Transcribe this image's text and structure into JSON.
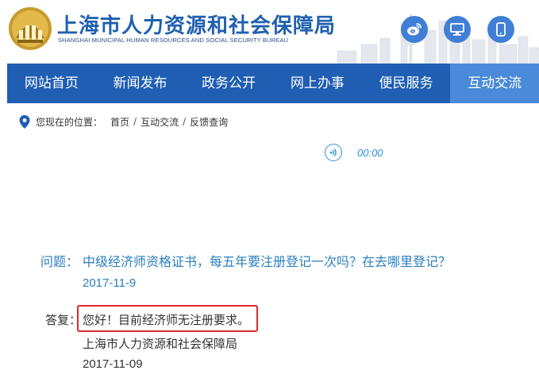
{
  "header": {
    "org_name": "上海市人力资源和社会保障局",
    "org_name_en": "SHANGHAI MUNICIPAL HUMAN RESOURCES AND SOCIAL SECURITY BUREAU",
    "icons": [
      "weibo-icon",
      "desktop-icon",
      "mobile-icon"
    ],
    "brand_color": "#1f5eb3",
    "icon_color": "#3f7fd6"
  },
  "nav": {
    "items": [
      {
        "label": "网站首页"
      },
      {
        "label": "新闻发布"
      },
      {
        "label": "政务公开"
      },
      {
        "label": "网上办事"
      },
      {
        "label": "便民服务"
      },
      {
        "label": "互动交流"
      }
    ],
    "active_label": "互动交流",
    "active_color": "#4a8ad8"
  },
  "breadcrumb": {
    "lead": "您现在的位置：",
    "items": [
      "首页",
      "互动交流",
      "反馈查询"
    ],
    "separator": "/"
  },
  "audio": {
    "time": "00:00",
    "color": "#2a90d8"
  },
  "qa": {
    "question_label": "问题：",
    "question_text": "中级经济师资格证书，每五年要注册登记一次吗？在去哪里登记？",
    "question_date": "2017-11-9",
    "answer_label": "答复：",
    "answer_text": "您好！目前经济师无注册要求。",
    "answer_org": "上海市人力资源和社会保障局",
    "answer_date": "2017-11-09",
    "highlight_color": "#e0262b",
    "question_color": "#2a7fc2"
  }
}
